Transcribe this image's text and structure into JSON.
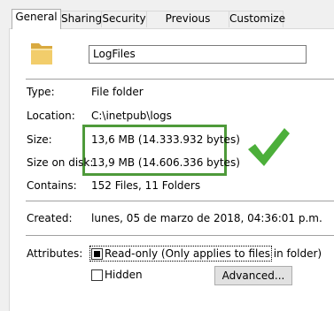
{
  "tabs": [
    "General",
    "Sharing",
    "Security",
    "Previous Versions",
    "Customize"
  ],
  "name_value": "LogFiles",
  "rows": {
    "type": {
      "label": "Type:",
      "value": "File folder"
    },
    "location": {
      "label": "Location:",
      "value": "C:\\inetpub\\logs"
    },
    "size": {
      "label": "Size:",
      "value": "13,6 MB (14.333.932 bytes)"
    },
    "size_on_disk": {
      "label": "Size on disk:",
      "value": "13,9 MB (14.606.336 bytes)"
    },
    "contains": {
      "label": "Contains:",
      "value": "152 Files, 11 Folders"
    },
    "created": {
      "label": "Created:",
      "value": "lunes, 05 de marzo de 2018, 04:36:01 p.m."
    }
  },
  "attributes": {
    "label": "Attributes:",
    "readonly_label": "Read-only (Only applies to files in folder)",
    "readonly_state": "indeterminate",
    "hidden_label": "Hidden",
    "hidden_checked": false,
    "advanced_label": "Advanced..."
  },
  "colors": {
    "highlight_box": "#4e9a3a",
    "checkmark": "#4caf3a",
    "folder": "#e8c064"
  },
  "icons": {
    "folder": "folder-icon",
    "checkmark": "checkmark-icon"
  }
}
